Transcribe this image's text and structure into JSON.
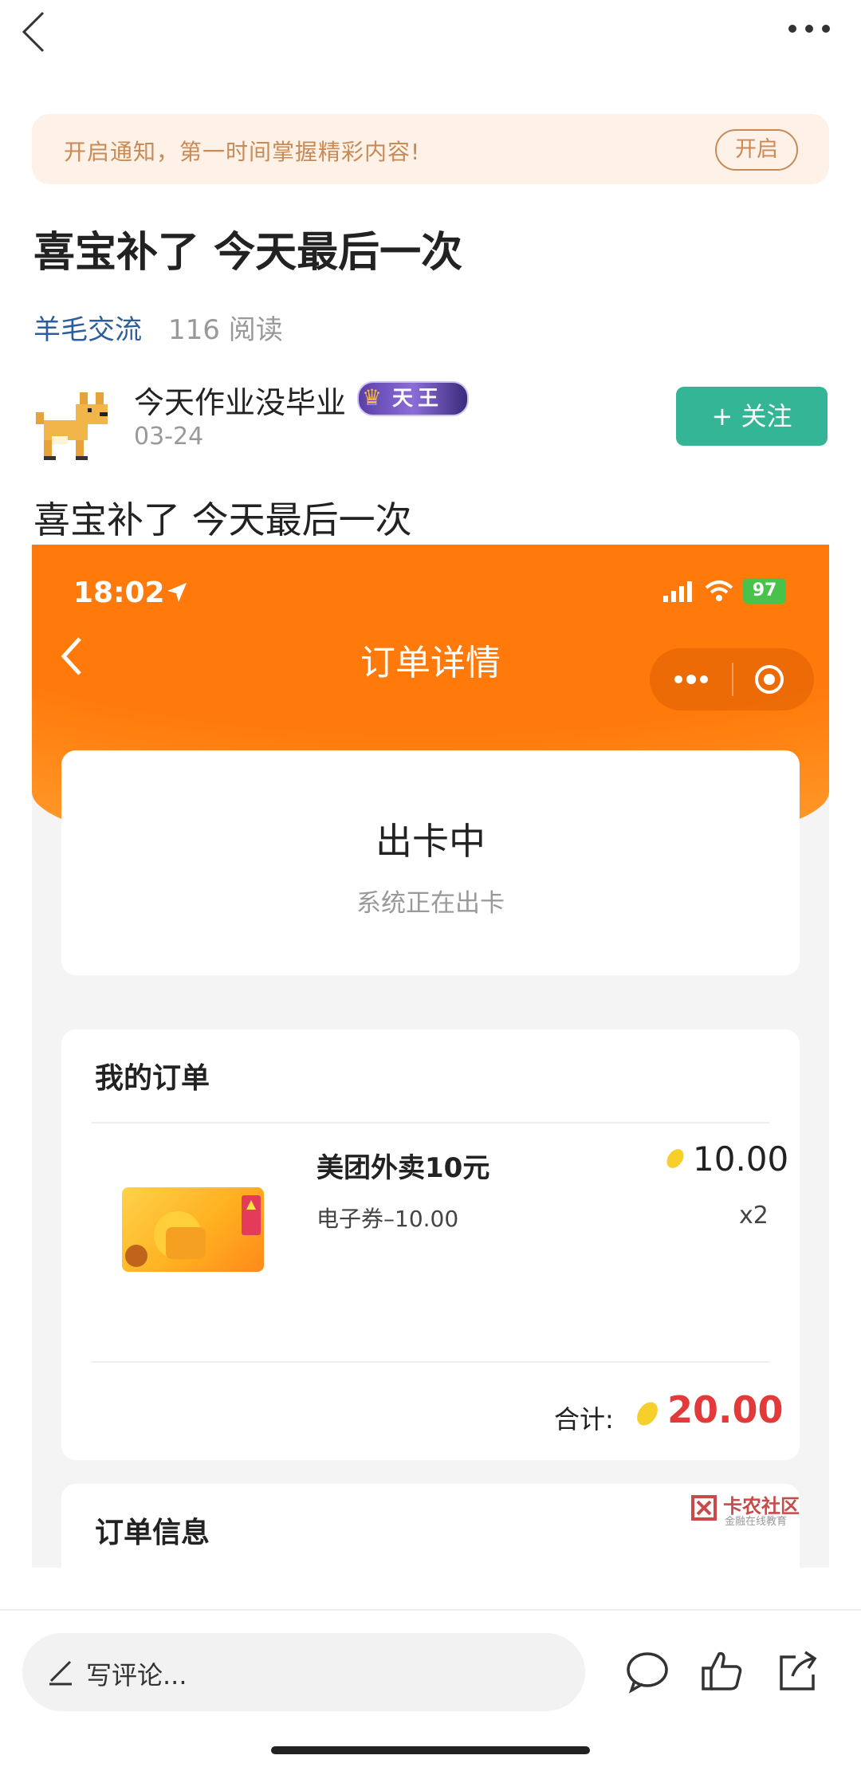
{
  "notify": {
    "text": "开启通知，第一时间掌握精彩内容!",
    "button": "开启"
  },
  "post": {
    "title": "喜宝补了 今天最后一次",
    "topic": "羊毛交流",
    "reads": "116 阅读",
    "author": "今天作业没毕业",
    "badge_text": "天王",
    "date": "03-24",
    "follow_label": "+ 关注",
    "body": "喜宝补了 今天最后一次"
  },
  "embedded": {
    "status_bar": {
      "time": "18:02",
      "battery": "97"
    },
    "nav_title": "订单详情",
    "status_card": {
      "title": "出卡中",
      "subtitle": "系统正在出卡"
    },
    "order": {
      "section_title": "我的订单",
      "product_name": "美团外卖10元",
      "product_desc": "电子券–10.00",
      "price": "10.00",
      "quantity": "x2",
      "total_label": "合计:",
      "total_value": "20.00"
    },
    "info_title": "订单信息",
    "watermark": {
      "name": "卡农社区",
      "sub": "金融在线教育"
    }
  },
  "bottom_bar": {
    "comment_placeholder": "写评论..."
  },
  "colors": {
    "accent_green": "#33b596",
    "orange": "#ff7a0a",
    "price_red": "#e23a3a"
  }
}
